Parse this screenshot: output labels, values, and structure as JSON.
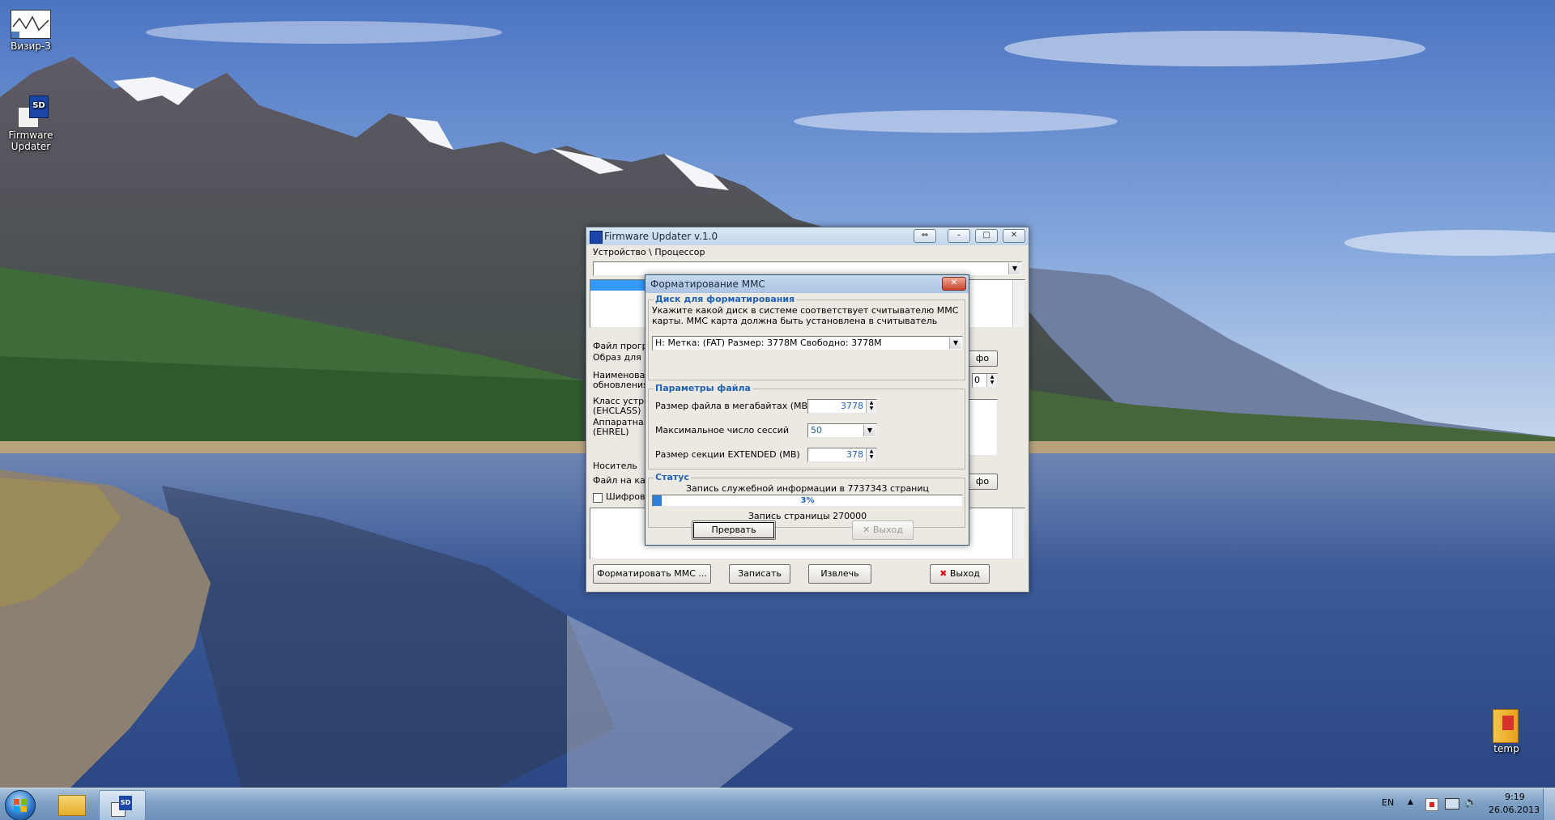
{
  "desktop": {
    "icons": [
      {
        "label": "Визир-3",
        "icon": "chart-shortcut-icon"
      },
      {
        "label": "Firmware Updater",
        "icon": "sd-card-shortcut-icon"
      },
      {
        "label": "temp",
        "icon": "folder-icon"
      }
    ]
  },
  "fw_window": {
    "title": "Firmware Updater v.1.0",
    "device_label": "Устройство \\ Процессор",
    "device_value": "",
    "file_group_label": "Файл прогр",
    "image_label": "Образ для з",
    "name_label_1": "Наименован",
    "name_label_2": "обновления",
    "class_label_1": "Класс устро",
    "class_label_2": "(EHCLASS)",
    "hw_label_1": "Аппаратная",
    "hw_label_2": "(EHREL)",
    "info_button_1": "фо",
    "info_button_2": "фо",
    "spin_value": "0",
    "media_group_label": "Носитель",
    "file_on_card_label": "Файл на кар",
    "encrypt_label": "Шифрова",
    "buttons": {
      "format_mmc": "Форматировать MMC ...",
      "write": "Записать",
      "extract": "Извлечь",
      "exit": "Выход"
    }
  },
  "mmc_dialog": {
    "title": "Форматирование MMC",
    "disk_group": {
      "title": "Диск для форматирования",
      "hint": "Укажите какой диск в системе соответствует считывателю MMC карты. MMC карта должна быть установлена в считыватель",
      "drive_select": "H:  Метка: (FAT)  Размер: 3778M  Свободно: 3778M"
    },
    "params_group": {
      "title": "Параметры файла",
      "file_size_label": "Размер файла в мегабайтах (MB)",
      "file_size_value": "3778",
      "max_sessions_label": "Максимальное число сессий",
      "max_sessions_value": "50",
      "extended_size_label": "Размер секции EXTENDED (MB)",
      "extended_size_value": "378"
    },
    "status_group": {
      "title": "Статус",
      "line1": "Запись служебной информации в 7737343 страниц",
      "progress_text": "3%",
      "progress_fraction": 0.03,
      "line2": "Запись страницы 270000"
    },
    "buttons": {
      "abort": "Прервать",
      "exit": "Выход"
    }
  },
  "taskbar": {
    "lang": "EN",
    "time": "9:19",
    "date": "26.06.2013"
  },
  "colors": {
    "accent_blue": "#1e62b7",
    "selection": "#3399ff",
    "progress": "#2d7fd8"
  }
}
